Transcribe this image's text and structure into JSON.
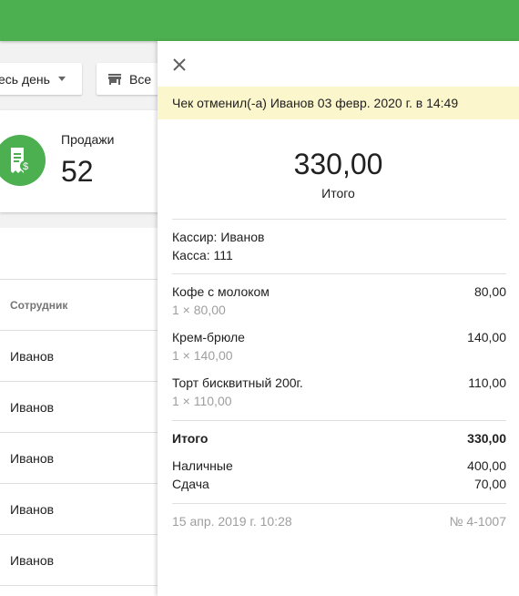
{
  "filters": {
    "period": "есь день",
    "store": "Все"
  },
  "sales_card": {
    "label": "Продажи",
    "value": "52"
  },
  "table": {
    "header": "Сотрудник",
    "rows": [
      "Иванов",
      "Иванов",
      "Иванов",
      "Иванов",
      "Иванов"
    ]
  },
  "receipt": {
    "banner": "Чек отменил(-а) Иванов 03 февр. 2020 г. в 14:49",
    "total_amount": "330,00",
    "total_label": "Итого",
    "cashier": "Кассир: Иванов",
    "register": "Касса: 111",
    "items": [
      {
        "name": "Кофе с молоком",
        "qty": "1 × 80,00",
        "amount": "80,00"
      },
      {
        "name": "Крем-брюле",
        "qty": "1 × 140,00",
        "amount": "140,00"
      },
      {
        "name": "Торт бисквитный 200г.",
        "qty": "1 × 110,00",
        "amount": "110,00"
      }
    ],
    "summary_label": "Итого",
    "summary_value": "330,00",
    "cash_label": "Наличные",
    "cash_value": "400,00",
    "change_label": "Сдача",
    "change_value": "70,00",
    "date": "15 апр. 2019 г. 10:28",
    "number": "№ 4-1007"
  },
  "colors": {
    "accent": "#4caf50",
    "banner": "#fcf6cd"
  },
  "icons": [
    "receipt-dollar-icon",
    "store-icon",
    "close-icon",
    "dropdown-caret-icon"
  ]
}
